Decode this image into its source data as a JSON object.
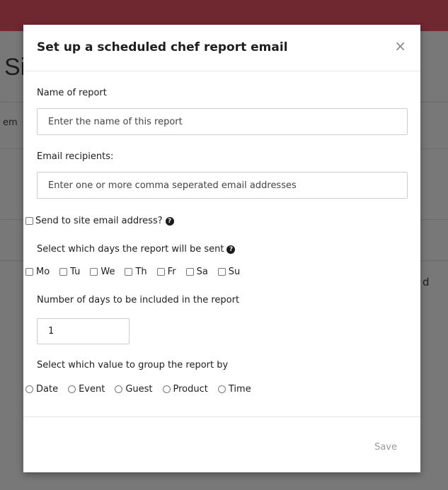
{
  "background": {
    "title_fragment": "Si",
    "left_fragment": "em",
    "right_fragment": "d"
  },
  "modal": {
    "title": "Set up a scheduled chef report email",
    "close_symbol": "×",
    "name_label": "Name of report",
    "name_placeholder": "Enter the name of this report",
    "recipients_label": "Email recipients:",
    "recipients_placeholder": "Enter one or more comma seperated email addresses",
    "site_email_label": "Send to site email address?",
    "days_label": "Select which days the report will be sent",
    "days": [
      "Mo",
      "Tu",
      "We",
      "Th",
      "Fr",
      "Sa",
      "Su"
    ],
    "num_days_label": "Number of days to be included in the report",
    "num_days_value": "1",
    "group_label": "Select which value to group the report by",
    "group_options": [
      "Date",
      "Event",
      "Guest",
      "Product",
      "Time"
    ],
    "save_label": "Save"
  },
  "colors": {
    "topbar": "#6f2730",
    "overlay_bg": "#787878",
    "modal_bg": "#ffffff"
  }
}
